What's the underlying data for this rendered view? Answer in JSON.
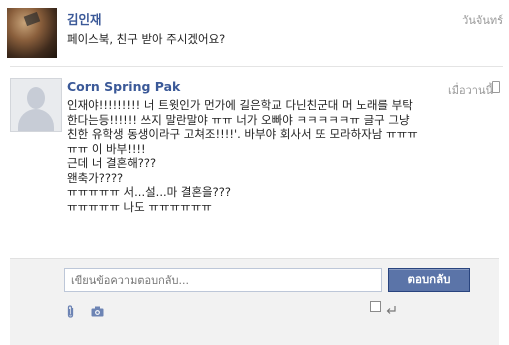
{
  "messages": [
    {
      "author": "김인재",
      "time": "วันจันทร์",
      "lines": [
        "페이스북, 친구 받아 주시겠어요?"
      ]
    },
    {
      "author": "Corn Spring Pak",
      "time": "เมื่อวานนี้",
      "lines": [
        "인재야!!!!!!!!! 너 트윗인가 먼가에 길은학교 다닌친군대 머 노래를 부탁한다는등!!!!!! 쓰지 말란말야 ㅠㅠ 너가 오빠야 ㅋㅋㅋㅋㅋㅠ 글구 그냥 친한 유학생 동생이라구 고쳐조!!!!'. 바부야 회사서 또 모라하자남 ㅠㅠㅠㅠㅠ 이 바부!!!!",
        "근데 너 결혼해???",
        "왠축가????",
        "ㅠㅠㅠㅠㅠ 서...설...마 결혼을???",
        "ㅠㅠㅠㅠㅠ 나도 ㅠㅠㅠㅠㅠㅠ"
      ]
    }
  ],
  "reply": {
    "placeholder": "เขียนข้อความตอบกลับ...",
    "button_label": "ตอบกลับ"
  },
  "icons": {
    "attach": "paperclip-icon",
    "photo": "camera-icon",
    "enter": "enter-key-icon",
    "mobile": "mobile-phone-icon"
  }
}
